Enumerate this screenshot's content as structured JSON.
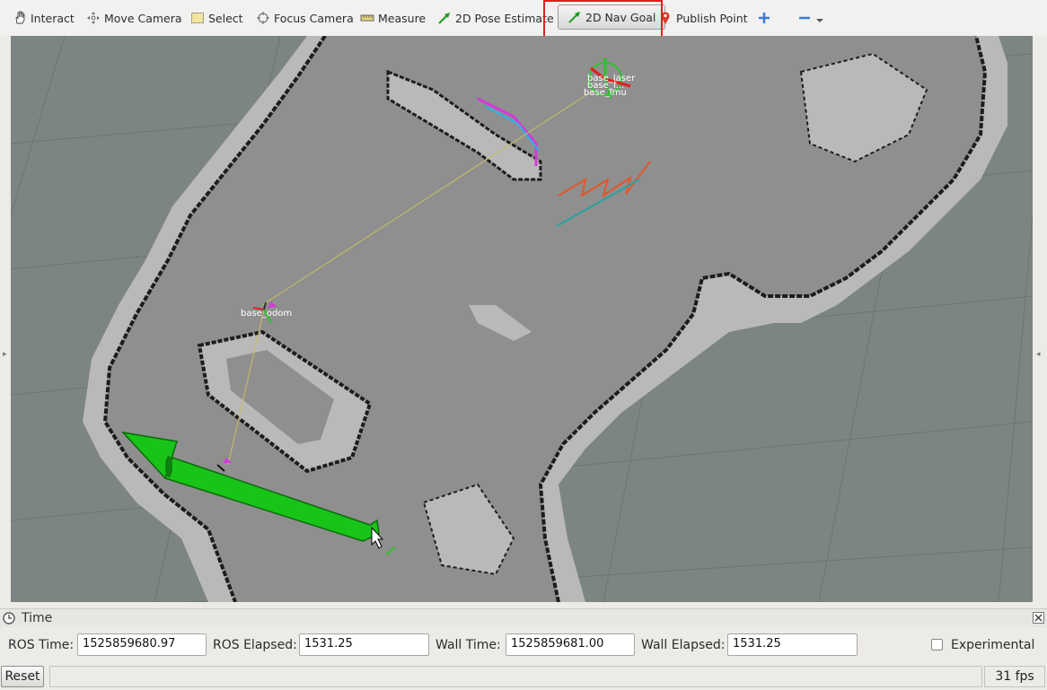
{
  "toolbar": {
    "tools": [
      {
        "label": "Interact",
        "icon": "hand-icon"
      },
      {
        "label": "Move Camera",
        "icon": "move-camera-icon"
      },
      {
        "label": "Select",
        "icon": "select-icon"
      },
      {
        "label": "Focus Camera",
        "icon": "focus-camera-icon"
      },
      {
        "label": "Measure",
        "icon": "ruler-icon"
      },
      {
        "label": "2D Pose Estimate",
        "icon": "green-arrow-icon"
      },
      {
        "label": "2D Nav Goal",
        "icon": "green-arrow-icon",
        "active": true
      },
      {
        "label": "Publish Point",
        "icon": "map-pin-icon"
      }
    ],
    "plus_icon": "plus-icon",
    "minus_icon": "minus-icon"
  },
  "viewport": {
    "frame_labels": {
      "laser": "base_laser",
      "footprint": "base_f...",
      "imu": "base_imu",
      "base_odom": "base_odom"
    }
  },
  "time_panel": {
    "title": "Time",
    "ros_time_label": "ROS Time:",
    "ros_time_value": "1525859680.97",
    "ros_elapsed_label": "ROS Elapsed:",
    "ros_elapsed_value": "1531.25",
    "wall_time_label": "Wall Time:",
    "wall_time_value": "1525859681.00",
    "wall_elapsed_label": "Wall Elapsed:",
    "wall_elapsed_value": "1531.25",
    "experimental_label": "Experimental"
  },
  "status_bar": {
    "reset_label": "Reset",
    "fps": "31 fps"
  },
  "colors": {
    "highlight": "#e02020",
    "goal_arrow": "#19c419",
    "map_free": "#8a8a8a",
    "map_unknown": "#7d8484",
    "inflation": "#b0b0b0"
  }
}
